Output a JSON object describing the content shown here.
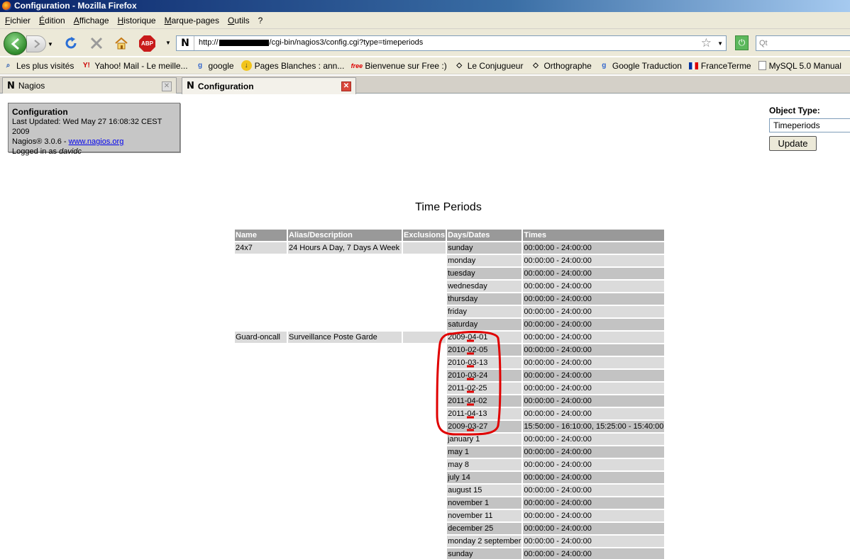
{
  "window": {
    "title": "Configuration - Mozilla Firefox"
  },
  "menu": [
    "Fichier",
    "Édition",
    "Affichage",
    "Historique",
    "Marque-pages",
    "Outils",
    "?"
  ],
  "nav": {
    "url_prefix": "http://",
    "url_suffix": "/cgi-bin/nagios3/config.cgi?type=timeperiods",
    "search_placeholder": "Qt",
    "abp_label": "ABP"
  },
  "bookmarks": [
    {
      "label": "Les plus visités",
      "icon": "magnifier-icon"
    },
    {
      "label": "Yahoo! Mail - Le meille...",
      "icon": "yahoo-icon"
    },
    {
      "label": "google",
      "icon": "google-icon"
    },
    {
      "label": "Pages Blanches : ann...",
      "icon": "pagesblanches-icon"
    },
    {
      "label": "Bienvenue sur Free :)",
      "icon": "free-icon"
    },
    {
      "label": "Le Conjugueur",
      "icon": "diamond-icon"
    },
    {
      "label": "Orthographe",
      "icon": "diamond-icon"
    },
    {
      "label": "Google Traduction",
      "icon": "google-icon"
    },
    {
      "label": "FranceTerme",
      "icon": "flag-icon"
    },
    {
      "label": "MySQL 5.0 Manual",
      "icon": "page-icon"
    }
  ],
  "tabs": [
    {
      "label": "Nagios",
      "active": false
    },
    {
      "label": "Configuration",
      "active": true
    }
  ],
  "info": {
    "title": "Configuration",
    "updated": "Last Updated: Wed May 27 16:08:32 CEST 2009",
    "version": "Nagios® 3.0.6 - ",
    "link": "www.nagios.org",
    "logged_prefix": "Logged in as ",
    "user": "davidc"
  },
  "object_type": {
    "label": "Object Type:",
    "selected": "Timeperiods",
    "button": "Update"
  },
  "page_title": "Time Periods",
  "table": {
    "headers": [
      "Name",
      "Alias/Description",
      "Exclusions",
      "Days/Dates",
      "Times"
    ],
    "rows": [
      {
        "name": "24x7",
        "alias": "24 Hours A Day, 7 Days A Week",
        "excl": "",
        "day": "sunday",
        "time": "00:00:00 - 24:00:00"
      },
      {
        "name": "",
        "alias": "",
        "excl": "",
        "day": "monday",
        "time": "00:00:00 - 24:00:00"
      },
      {
        "name": "",
        "alias": "",
        "excl": "",
        "day": "tuesday",
        "time": "00:00:00 - 24:00:00"
      },
      {
        "name": "",
        "alias": "",
        "excl": "",
        "day": "wednesday",
        "time": "00:00:00 - 24:00:00"
      },
      {
        "name": "",
        "alias": "",
        "excl": "",
        "day": "thursday",
        "time": "00:00:00 - 24:00:00"
      },
      {
        "name": "",
        "alias": "",
        "excl": "",
        "day": "friday",
        "time": "00:00:00 - 24:00:00"
      },
      {
        "name": "",
        "alias": "",
        "excl": "",
        "day": "saturday",
        "time": "00:00:00 - 24:00:00"
      },
      {
        "name": "Guard-oncall",
        "alias": "Surveillance Poste Garde",
        "excl": "",
        "day": "2009-04-01",
        "time": "00:00:00 - 24:00:00"
      },
      {
        "name": "",
        "alias": "",
        "excl": "",
        "day": "2010-02-05",
        "time": "00:00:00 - 24:00:00"
      },
      {
        "name": "",
        "alias": "",
        "excl": "",
        "day": "2010-03-13",
        "time": "00:00:00 - 24:00:00"
      },
      {
        "name": "",
        "alias": "",
        "excl": "",
        "day": "2010-03-24",
        "time": "00:00:00 - 24:00:00"
      },
      {
        "name": "",
        "alias": "",
        "excl": "",
        "day": "2011-02-25",
        "time": "00:00:00 - 24:00:00"
      },
      {
        "name": "",
        "alias": "",
        "excl": "",
        "day": "2011-04-02",
        "time": "00:00:00 - 24:00:00"
      },
      {
        "name": "",
        "alias": "",
        "excl": "",
        "day": "2011-04-13",
        "time": "00:00:00 - 24:00:00"
      },
      {
        "name": "",
        "alias": "",
        "excl": "",
        "day": "2009-03-27",
        "time": "15:50:00 - 16:10:00, 15:25:00 - 15:40:00"
      },
      {
        "name": "",
        "alias": "",
        "excl": "",
        "day": "january 1",
        "time": "00:00:00 - 24:00:00"
      },
      {
        "name": "",
        "alias": "",
        "excl": "",
        "day": "may 1",
        "time": "00:00:00 - 24:00:00"
      },
      {
        "name": "",
        "alias": "",
        "excl": "",
        "day": "may 8",
        "time": "00:00:00 - 24:00:00"
      },
      {
        "name": "",
        "alias": "",
        "excl": "",
        "day": "july 14",
        "time": "00:00:00 - 24:00:00"
      },
      {
        "name": "",
        "alias": "",
        "excl": "",
        "day": "august 15",
        "time": "00:00:00 - 24:00:00"
      },
      {
        "name": "",
        "alias": "",
        "excl": "",
        "day": "november 1",
        "time": "00:00:00 - 24:00:00"
      },
      {
        "name": "",
        "alias": "",
        "excl": "",
        "day": "november 11",
        "time": "00:00:00 - 24:00:00"
      },
      {
        "name": "",
        "alias": "",
        "excl": "",
        "day": "december 25",
        "time": "00:00:00 - 24:00:00"
      },
      {
        "name": "",
        "alias": "",
        "excl": "",
        "day": "monday 2 september",
        "time": "00:00:00 - 24:00:00"
      },
      {
        "name": "",
        "alias": "",
        "excl": "",
        "day": "sunday",
        "time": "00:00:00 - 24:00:00"
      }
    ]
  },
  "colors": {
    "annotation": "#e00000",
    "header_bg": "#999999"
  }
}
